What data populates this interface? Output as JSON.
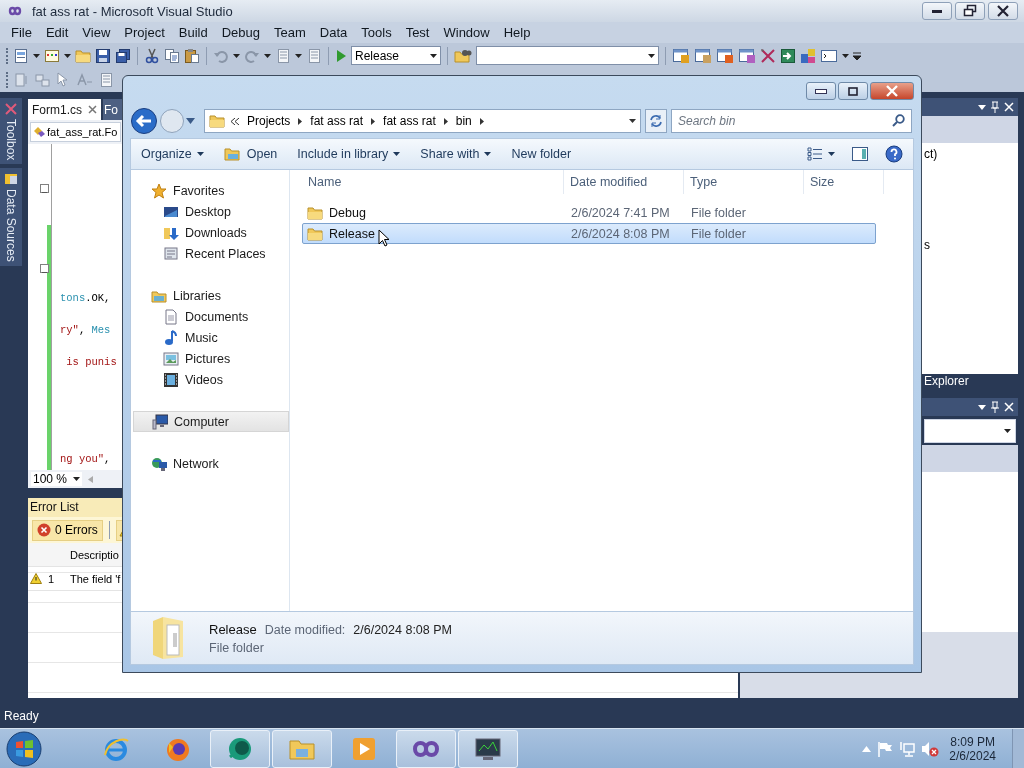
{
  "window": {
    "title": "fat ass rat - Microsoft Visual Studio"
  },
  "menu": [
    "File",
    "Edit",
    "View",
    "Project",
    "Build",
    "Debug",
    "Team",
    "Data",
    "Tools",
    "Test",
    "Window",
    "Help"
  ],
  "toolbar": {
    "solution_configuration": "Release"
  },
  "side_tabs": [
    {
      "label": "Toolbox"
    },
    {
      "label": "Data Sources"
    }
  ],
  "editor": {
    "tabs": [
      {
        "label": "Form1.cs",
        "selected": true
      },
      {
        "label": "Fo",
        "selected": false
      }
    ],
    "type_dropdown": "fat_ass_rat.Fo",
    "lines": [
      {
        "segments": [
          {
            "text": "tons",
            "kind": "type"
          },
          {
            "text": ".OK,",
            "kind": "plain"
          }
        ]
      },
      {
        "segments": [
          {
            "text": "ry\"",
            "kind": "string"
          },
          {
            "text": ", ",
            "kind": "plain"
          },
          {
            "text": "Mes",
            "kind": "type"
          }
        ]
      },
      {
        "segments": [
          {
            "text": " is punis",
            "kind": "string"
          }
        ]
      },
      {
        "segments": [
          {
            "text": "ng you\"",
            "kind": "string"
          },
          {
            "text": ",",
            "kind": "plain"
          }
        ]
      }
    ],
    "zoom": "100 %"
  },
  "error_list": {
    "title": "Error List",
    "filters": [
      "0 Errors"
    ],
    "columns": [
      "Descriptio"
    ],
    "rows": [
      {
        "number": "1",
        "description": "The field 'f"
      }
    ]
  },
  "right_panel": {
    "lines": [
      "ct)",
      "s"
    ],
    "tab": "Explorer"
  },
  "status_bar": "Ready",
  "explorer": {
    "breadcrumb": [
      "Projects",
      "fat ass rat",
      "fat ass rat",
      "bin"
    ],
    "search": {
      "placeholder": "Search bin"
    },
    "commands": [
      {
        "label": "Organize",
        "menu": true
      },
      {
        "label": "Open",
        "menu": false
      },
      {
        "label": "Include in library",
        "menu": true
      },
      {
        "label": "Share with",
        "menu": true
      },
      {
        "label": "New folder",
        "menu": false
      }
    ],
    "nav": [
      {
        "label": "Favorites",
        "kind": "favorites",
        "selected": false,
        "children": [
          {
            "label": "Desktop",
            "kind": "desktop",
            "selected": false
          },
          {
            "label": "Downloads",
            "kind": "downloads",
            "selected": false
          },
          {
            "label": "Recent Places",
            "kind": "recent",
            "selected": false
          }
        ]
      },
      {
        "label": "Libraries",
        "kind": "libraries",
        "selected": false,
        "children": [
          {
            "label": "Documents",
            "kind": "documents",
            "selected": false
          },
          {
            "label": "Music",
            "kind": "music",
            "selected": false
          },
          {
            "label": "Pictures",
            "kind": "pictures",
            "selected": false
          },
          {
            "label": "Videos",
            "kind": "videos",
            "selected": false
          }
        ]
      },
      {
        "label": "Computer",
        "kind": "computer",
        "selected": true
      },
      {
        "label": "Network",
        "kind": "network",
        "selected": false
      }
    ],
    "columns": [
      "Name",
      "Date modified",
      "Type",
      "Size"
    ],
    "rows": [
      {
        "name": "Debug",
        "date": "2/6/2024 7:41 PM",
        "type": "File folder",
        "selected": false
      },
      {
        "name": "Release",
        "date": "2/6/2024 8:08 PM",
        "type": "File folder",
        "selected": true
      }
    ],
    "details": {
      "name": "Release",
      "date_label": "Date modified:",
      "date": "2/6/2024 8:08 PM",
      "type": "File folder"
    }
  },
  "taskbar": {
    "items": [
      {
        "running": false
      },
      {
        "running": false
      },
      {
        "running": true
      },
      {
        "running": true
      },
      {
        "running": false
      },
      {
        "running": true
      },
      {
        "running": true
      }
    ],
    "time": "8:09 PM",
    "date": "2/6/2024"
  }
}
